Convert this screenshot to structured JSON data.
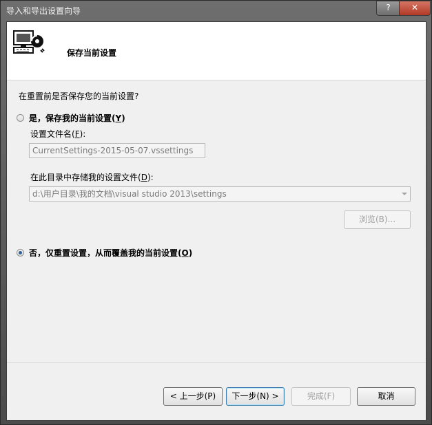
{
  "window": {
    "title": "导入和导出设置向导",
    "help_button": "?",
    "close_button": "✕"
  },
  "header": {
    "title": "保存当前设置",
    "icon": "computer-settings-icon"
  },
  "question": "在重置前是否保存您的当前设置?",
  "option_save": {
    "label": "是，保存我的当前设置(",
    "accesskey": "Y",
    "label_end": ")",
    "checked": false
  },
  "filename": {
    "label": "设置文件名(",
    "accesskey": "F",
    "label_end": "):",
    "value": "CurrentSettings-2015-05-07.vssettings"
  },
  "directory": {
    "label": "在此目录中存储我的设置文件(",
    "accesskey": "D",
    "label_end": "):",
    "value": "d:\\用户目录\\我的文档\\visual studio 2013\\settings"
  },
  "browse_button": "浏览(B)...",
  "option_overwrite": {
    "label": "否，仅重置设置，从而覆盖我的当前设置(",
    "accesskey": "O",
    "label_end": ")",
    "checked": true
  },
  "footer": {
    "back": "< 上一步(P)",
    "next": "下一步(N) >",
    "finish": "完成(F)",
    "cancel": "取消"
  },
  "colors": {
    "title_bar": "#5e5e5e",
    "client_bg": "#f0f0f0",
    "header_bg": "#ffffff",
    "close_button": "#c94b37"
  }
}
